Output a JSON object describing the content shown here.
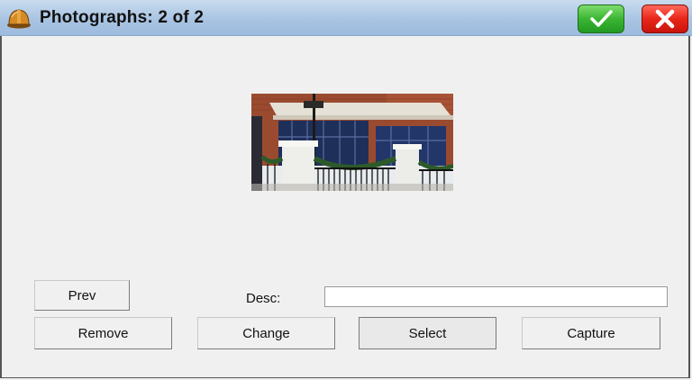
{
  "titlebar": {
    "title": "Photographs: 2 of 2",
    "app_icon": "hard-hat-icon",
    "ok_icon": "checkmark-icon",
    "cancel_icon": "x-icon",
    "ok_color": "#3cb533",
    "cancel_color": "#e8261a"
  },
  "photo": {
    "subject": "brick storefront with white columns and iron railing"
  },
  "form": {
    "prev_label": "Prev",
    "desc_label": "Desc:",
    "desc_value": "",
    "desc_placeholder": ""
  },
  "actions": {
    "remove_label": "Remove",
    "change_label": "Change",
    "select_label": "Select",
    "capture_label": "Capture"
  }
}
